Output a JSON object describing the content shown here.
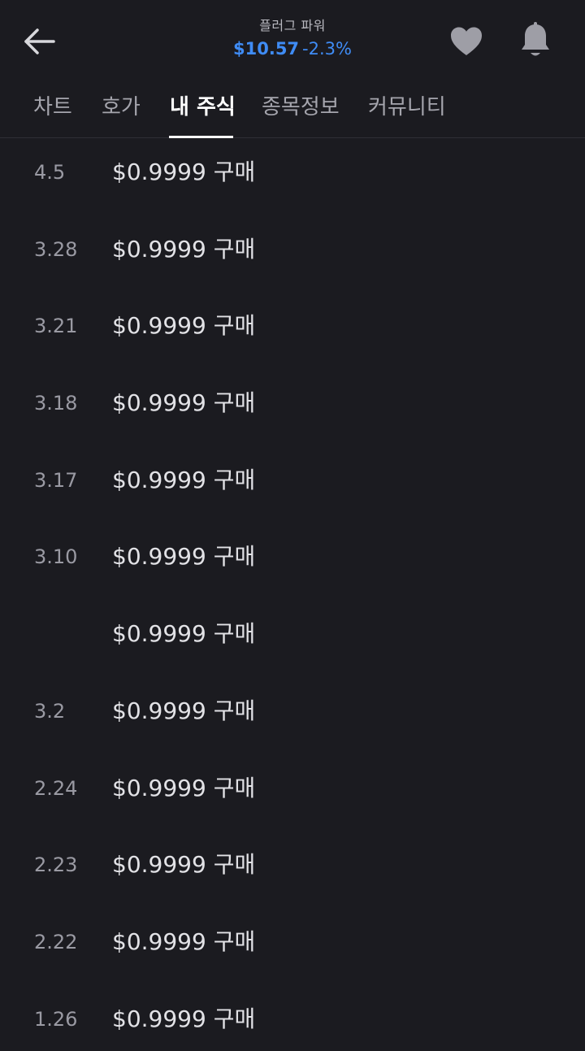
{
  "header": {
    "stock_name": "플러그 파워",
    "price": "$10.57",
    "change": "-2.3%",
    "icons": [
      "back-arrow-icon",
      "heart-icon",
      "bell-icon"
    ]
  },
  "tabs": [
    {
      "label": "차트",
      "active": false
    },
    {
      "label": "호가",
      "active": false
    },
    {
      "label": "내 주식",
      "active": true
    },
    {
      "label": "종목정보",
      "active": false
    },
    {
      "label": "커뮤니티",
      "active": false
    }
  ],
  "transactions": [
    {
      "date": "4.5",
      "amount": "$0.9999",
      "type": "구매"
    },
    {
      "date": "3.28",
      "amount": "$0.9999",
      "type": "구매"
    },
    {
      "date": "3.21",
      "amount": "$0.9999",
      "type": "구매"
    },
    {
      "date": "3.18",
      "amount": "$0.9999",
      "type": "구매"
    },
    {
      "date": "3.17",
      "amount": "$0.9999",
      "type": "구매"
    },
    {
      "date": "3.10",
      "amount": "$0.9999",
      "type": "구매"
    },
    {
      "date": "",
      "amount": "$0.9999",
      "type": "구매"
    },
    {
      "date": "3.2",
      "amount": "$0.9999",
      "type": "구매"
    },
    {
      "date": "2.24",
      "amount": "$0.9999",
      "type": "구매"
    },
    {
      "date": "2.23",
      "amount": "$0.9999",
      "type": "구매"
    },
    {
      "date": "2.22",
      "amount": "$0.9999",
      "type": "구매"
    },
    {
      "date": "1.26",
      "amount": "$0.9999",
      "type": "구매"
    }
  ],
  "colors": {
    "background": "#1b1b20",
    "accent_blue": "#3f8cf5",
    "text_primary": "#e2e2e6",
    "text_secondary": "#9a9aa3",
    "icon_gray": "#9e9ea6"
  }
}
